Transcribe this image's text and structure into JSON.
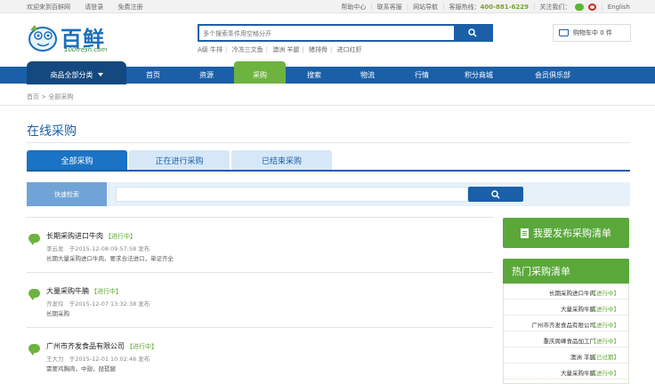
{
  "topbar": {
    "welcome": "欢迎来到百鲜网",
    "login": "请登录",
    "register": "免费注册",
    "help": "帮助中心",
    "service": "联系客服",
    "sitemap": "网站导航",
    "hotline_label": "客服热线：",
    "hotline": "400-881-6229",
    "follow": "关注我们：",
    "english": "English"
  },
  "logo": {
    "name": "百鲜",
    "sub": "100fresh.com"
  },
  "search": {
    "placeholder": "多个搜索条件用空格分开",
    "hotwords": [
      "A级 牛排",
      "冷冻三文鱼",
      "澳洲 羊腿",
      "猪排骨",
      "进口红虾"
    ]
  },
  "cart": {
    "label": "购物车中 0 件"
  },
  "nav": {
    "all_categories": "商品全部分类",
    "items": [
      "首页",
      "资源",
      "采购",
      "搜索",
      "物流",
      "行情",
      "积分商城",
      "会员俱乐部"
    ]
  },
  "breadcrumb": {
    "home": "首页",
    "sep": ">",
    "current": "全部采购"
  },
  "page": {
    "title": "在线采购"
  },
  "tabs": [
    "全部采购",
    "正在进行采购",
    "已结束采购"
  ],
  "quick_search": {
    "label": "快速检索",
    "value": ""
  },
  "list": [
    {
      "title": "长期采购进口牛肉",
      "status": "【进行中】",
      "author": "李云发",
      "time": "于2015-12-08 09:57:58 发布",
      "desc": "长期大量采购进口牛肉，要求合法进口，单证齐全"
    },
    {
      "title": "大量采购牛腩",
      "status": "【进行中】",
      "author": "齐发玲",
      "time": "于2015-12-07 13:32:38 发布",
      "desc": "长期采购"
    },
    {
      "title": "广州市齐发食品有限公司",
      "status": "【进行中】",
      "author": "王大力",
      "time": "于2015-12-01 10:02:46 发布",
      "desc": "需要鸡胸肉，中翅，琵琶腿"
    }
  ],
  "sidebar": {
    "publish": "我要发布采购清单",
    "hot_title": "热门采购清单",
    "hot_items": [
      {
        "name": "长期采购进口牛肉",
        "status": "【进行中】"
      },
      {
        "name": "大量采购牛腩",
        "status": "【进行中】"
      },
      {
        "name": "广州市齐发食品有限公司",
        "status": "【进行中】"
      },
      {
        "name": "重庆周峰食品加工厂",
        "status": "【进行中】"
      },
      {
        "name": "澳洲 羊腿",
        "status": "【已过期】"
      },
      {
        "name": "大量采购牛腩",
        "status": "【进行中】"
      }
    ]
  }
}
